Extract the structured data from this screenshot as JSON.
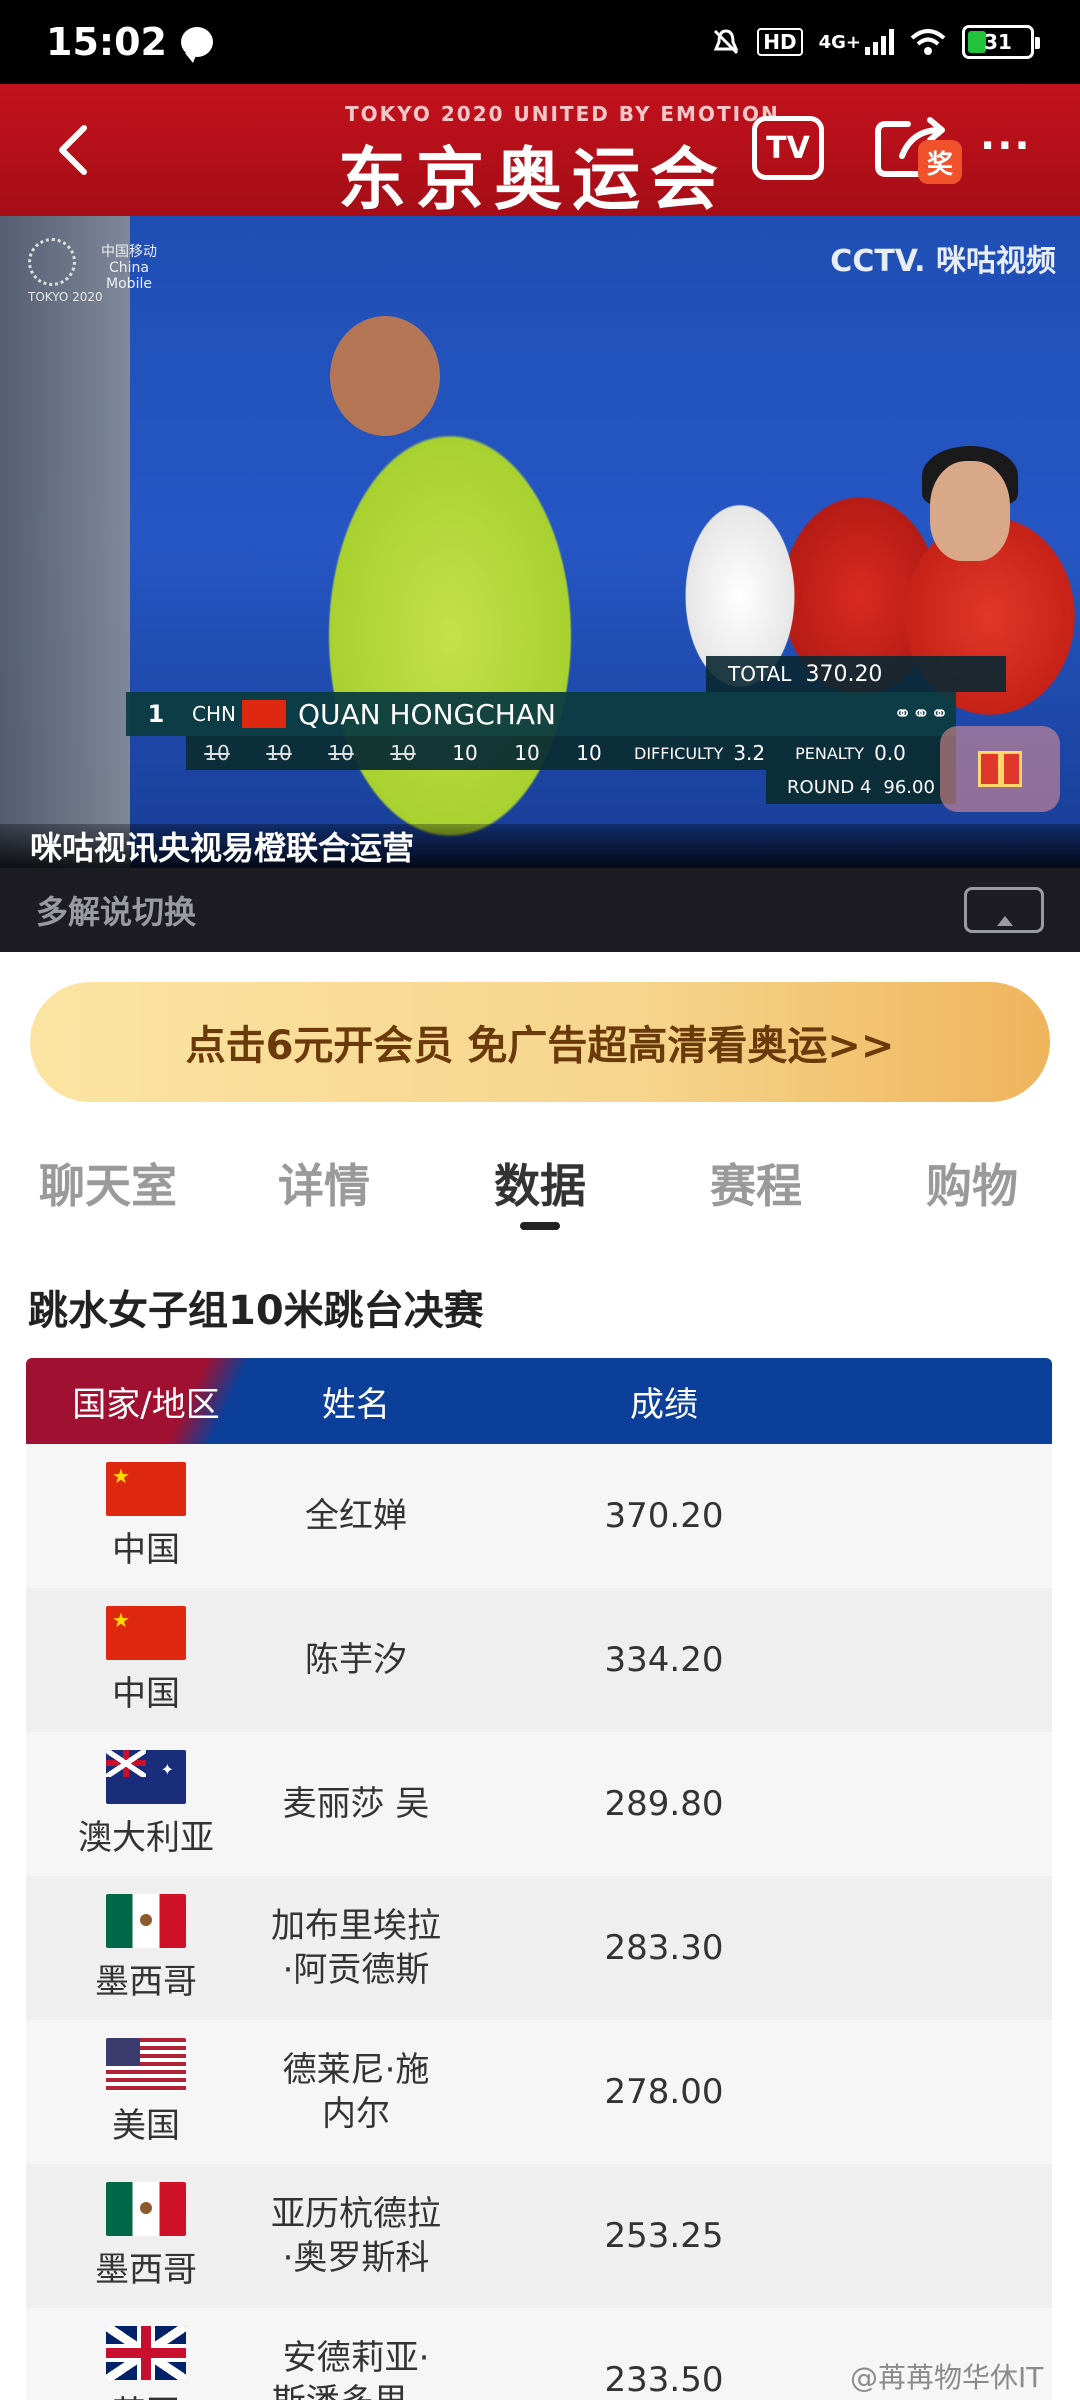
{
  "status": {
    "time": "15:02",
    "network": "4G+",
    "hd": "HD",
    "battery": "31"
  },
  "header": {
    "subtitle": "TOKYO 2020 UNITED BY EMOTION",
    "title": "东京奥运会",
    "tv_label": "TV",
    "reward_badge": "奖",
    "more": "···"
  },
  "video": {
    "logo_text": "TOKYO 2020",
    "sponsor": "中国移动 China Mobile",
    "broadcaster": "CCTV. 咪咕视频",
    "caption": "咪咕视讯央视易橙联合运营",
    "scoreboard": {
      "total_label": "TOTAL",
      "total": "370.20",
      "rank": "1",
      "country_code": "CHN",
      "athlete": "QUAN HONGCHAN",
      "judges": [
        "10",
        "10",
        "10",
        "10",
        "10",
        "10",
        "10"
      ],
      "difficulty_label": "DIFFICULTY",
      "difficulty": "3.2",
      "penalty_label": "PENALTY",
      "penalty": "0.0",
      "round_label": "ROUND 4",
      "round_score": "96.00"
    }
  },
  "commentary": {
    "label": "多解说切换"
  },
  "banner": {
    "text": "点击6元开会员 免广告超高清看奥运>>"
  },
  "tabs": [
    {
      "label": "聊天室"
    },
    {
      "label": "详情"
    },
    {
      "label": "数据"
    },
    {
      "label": "赛程"
    },
    {
      "label": "购物"
    }
  ],
  "section": {
    "title": "跳水女子组10米跳台决赛"
  },
  "table": {
    "headers": {
      "country": "国家/地区",
      "name": "姓名",
      "score": "成绩"
    },
    "rows": [
      {
        "country": "中国",
        "flag": "flag-cn",
        "name": "全红婵",
        "score": "370.20"
      },
      {
        "country": "中国",
        "flag": "flag-cn",
        "name": "陈芋汐",
        "score": "334.20"
      },
      {
        "country": "澳大利亚",
        "flag": "flag-au",
        "name": "麦丽莎 吴",
        "score": "289.80"
      },
      {
        "country": "墨西哥",
        "flag": "flag-mx",
        "name": "加布里埃拉 ·阿贡德斯",
        "score": "283.30"
      },
      {
        "country": "美国",
        "flag": "flag-us",
        "name": "德莱尼·施 内尔",
        "score": "278.00"
      },
      {
        "country": "墨西哥",
        "flag": "flag-mx",
        "name": "亚历杭德拉 ·奥罗斯科",
        "score": "253.25"
      },
      {
        "country": "英国",
        "flag": "flag-gb",
        "name": "安德莉亚· 斯潘多里...",
        "score": "233.50"
      }
    ]
  },
  "watermark": "@苒苒物华休IT"
}
